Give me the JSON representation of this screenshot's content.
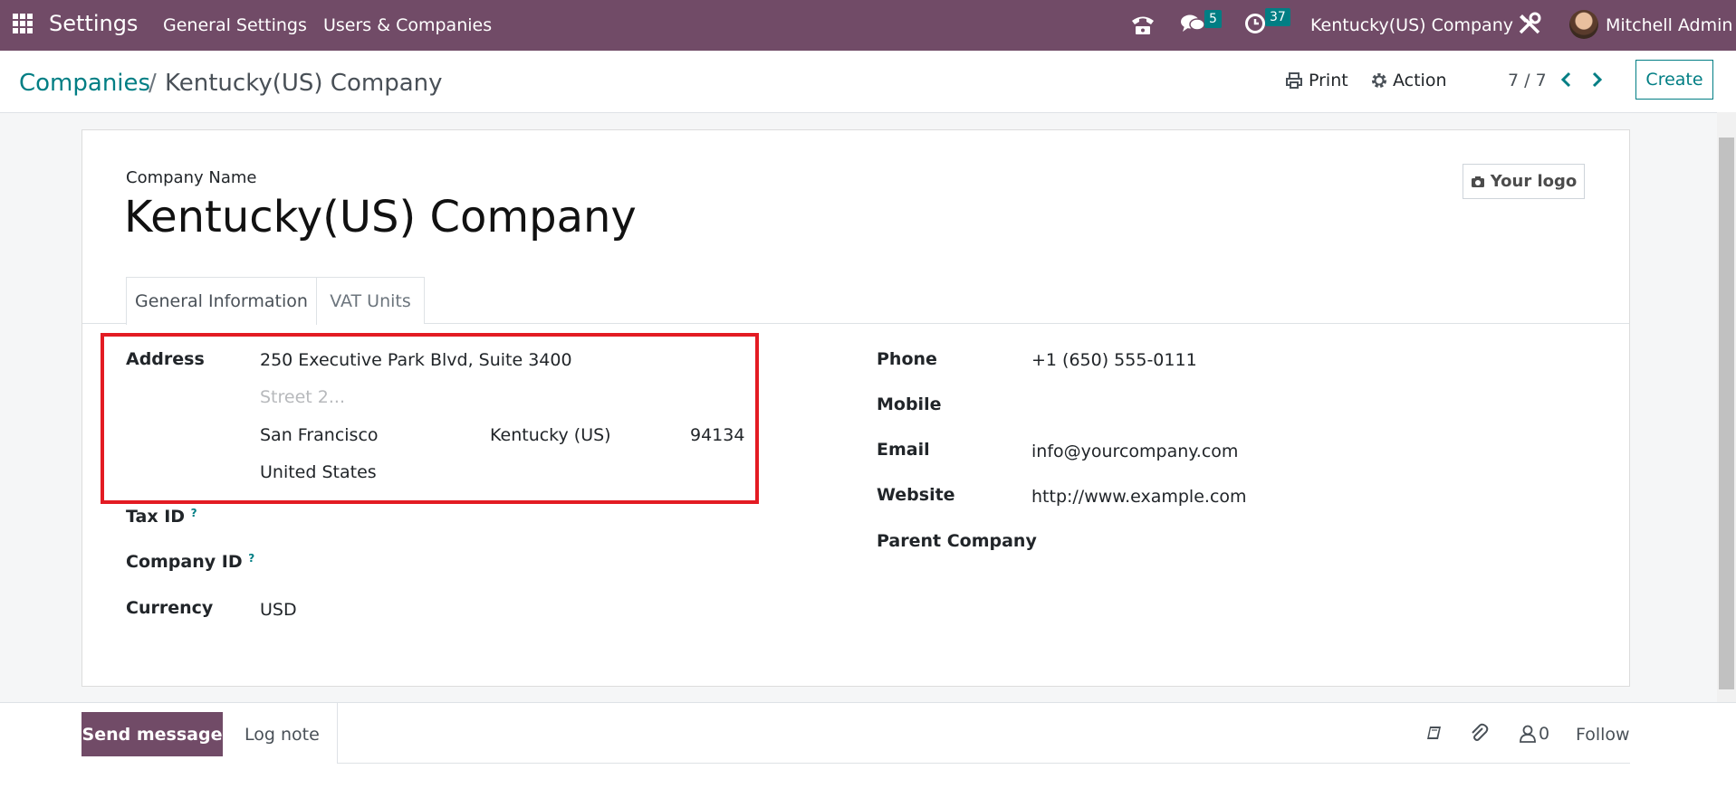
{
  "topbar": {
    "app_name": "Settings",
    "menu": [
      "General Settings",
      "Users & Companies"
    ],
    "messages_count": "5",
    "activities_count": "37",
    "company": "Kentucky(US) Company",
    "user": "Mitchell Admin",
    "colors": {
      "brand": "#714b67",
      "badge": "#017e84"
    }
  },
  "control": {
    "breadcrumb_parent": "Companies",
    "breadcrumb_separator": "/",
    "breadcrumb_current": "Kentucky(US) Company",
    "print_label": "Print",
    "action_label": "Action",
    "pager": "7 / 7",
    "create_label": "Create"
  },
  "form": {
    "company_name_label": "Company Name",
    "company_name": "Kentucky(US) Company",
    "logo_label": "Your logo",
    "tabs": [
      "General Information",
      "VAT Units"
    ],
    "active_tab": "General Information",
    "address_label": "Address",
    "street": "250 Executive Park Blvd, Suite 3400",
    "street2_placeholder": "Street 2...",
    "city": "San Francisco",
    "state": "Kentucky (US)",
    "zip": "94134",
    "country": "United States",
    "tax_id_label": "Tax ID",
    "company_id_label": "Company ID",
    "help_mark": "?",
    "currency_label": "Currency",
    "currency": "USD",
    "phone_label": "Phone",
    "phone": "+1 (650) 555-0111",
    "mobile_label": "Mobile",
    "email_label": "Email",
    "email": "info@yourcompany.com",
    "website_label": "Website",
    "website": "http://www.example.com",
    "parent_company_label": "Parent Company",
    "highlight_color": "#e31b23"
  },
  "chatter": {
    "send_message_label": "Send message",
    "log_note_label": "Log note",
    "followers_count": "0",
    "follow_label": "Follow"
  }
}
